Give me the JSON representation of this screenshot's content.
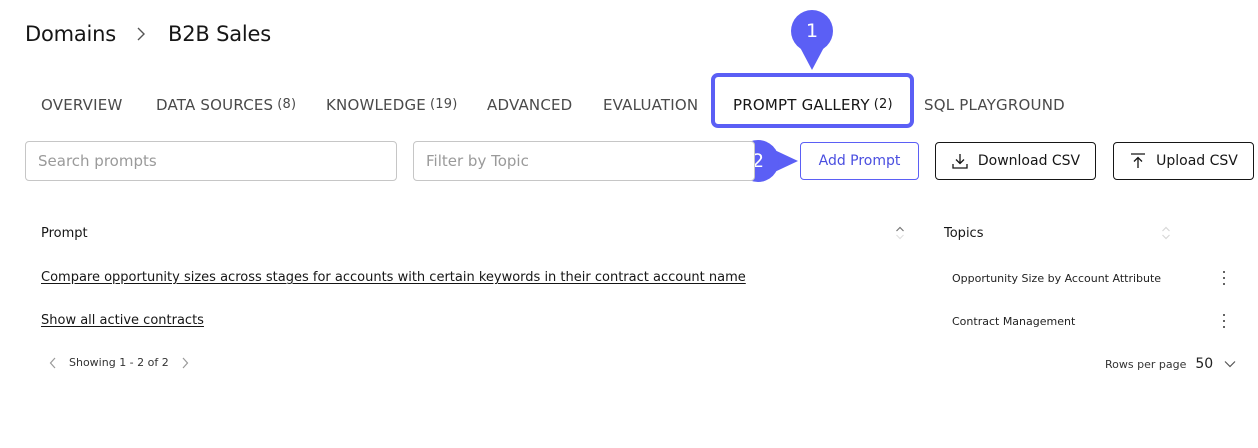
{
  "breadcrumb": {
    "root": "Domains",
    "current": "B2B Sales"
  },
  "tabs": [
    {
      "label": "OVERVIEW",
      "count": ""
    },
    {
      "label": "DATA SOURCES",
      "count": "(8)"
    },
    {
      "label": "KNOWLEDGE",
      "count": "(19)"
    },
    {
      "label": "ADVANCED",
      "count": ""
    },
    {
      "label": "EVALUATION",
      "count": ""
    },
    {
      "label": "PROMPT GALLERY",
      "count": "(2)"
    },
    {
      "label": "SQL PLAYGROUND",
      "count": ""
    }
  ],
  "active_tab": "PROMPT GALLERY",
  "callouts": [
    "1",
    "2"
  ],
  "toolbar": {
    "search_placeholder": "Search prompts",
    "topic_placeholder": "Filter by Topic",
    "add_label": "Add Prompt",
    "download_label": "Download CSV",
    "upload_label": "Upload CSV"
  },
  "table": {
    "columns": [
      "Prompt",
      "Topics"
    ],
    "rows": [
      {
        "prompt": "Compare opportunity sizes across stages for accounts with certain keywords in their contract account name",
        "topic": "Opportunity Size by Account Attribute"
      },
      {
        "prompt": "Show all active contracts",
        "topic": "Contract Management"
      }
    ]
  },
  "pagination": {
    "showing": "Showing 1 - 2 of 2",
    "rows_per_page_label": "Rows per page",
    "rows_per_page_value": "50"
  },
  "colors": {
    "accent": "#5b5ff5",
    "text": "#161616",
    "border": "#c6c6c6"
  },
  "icons": [
    "chevron-right-icon",
    "download-icon",
    "upload-icon",
    "sort-icon",
    "kebab-menu-icon",
    "chevron-left-icon",
    "chevron-down-icon"
  ]
}
